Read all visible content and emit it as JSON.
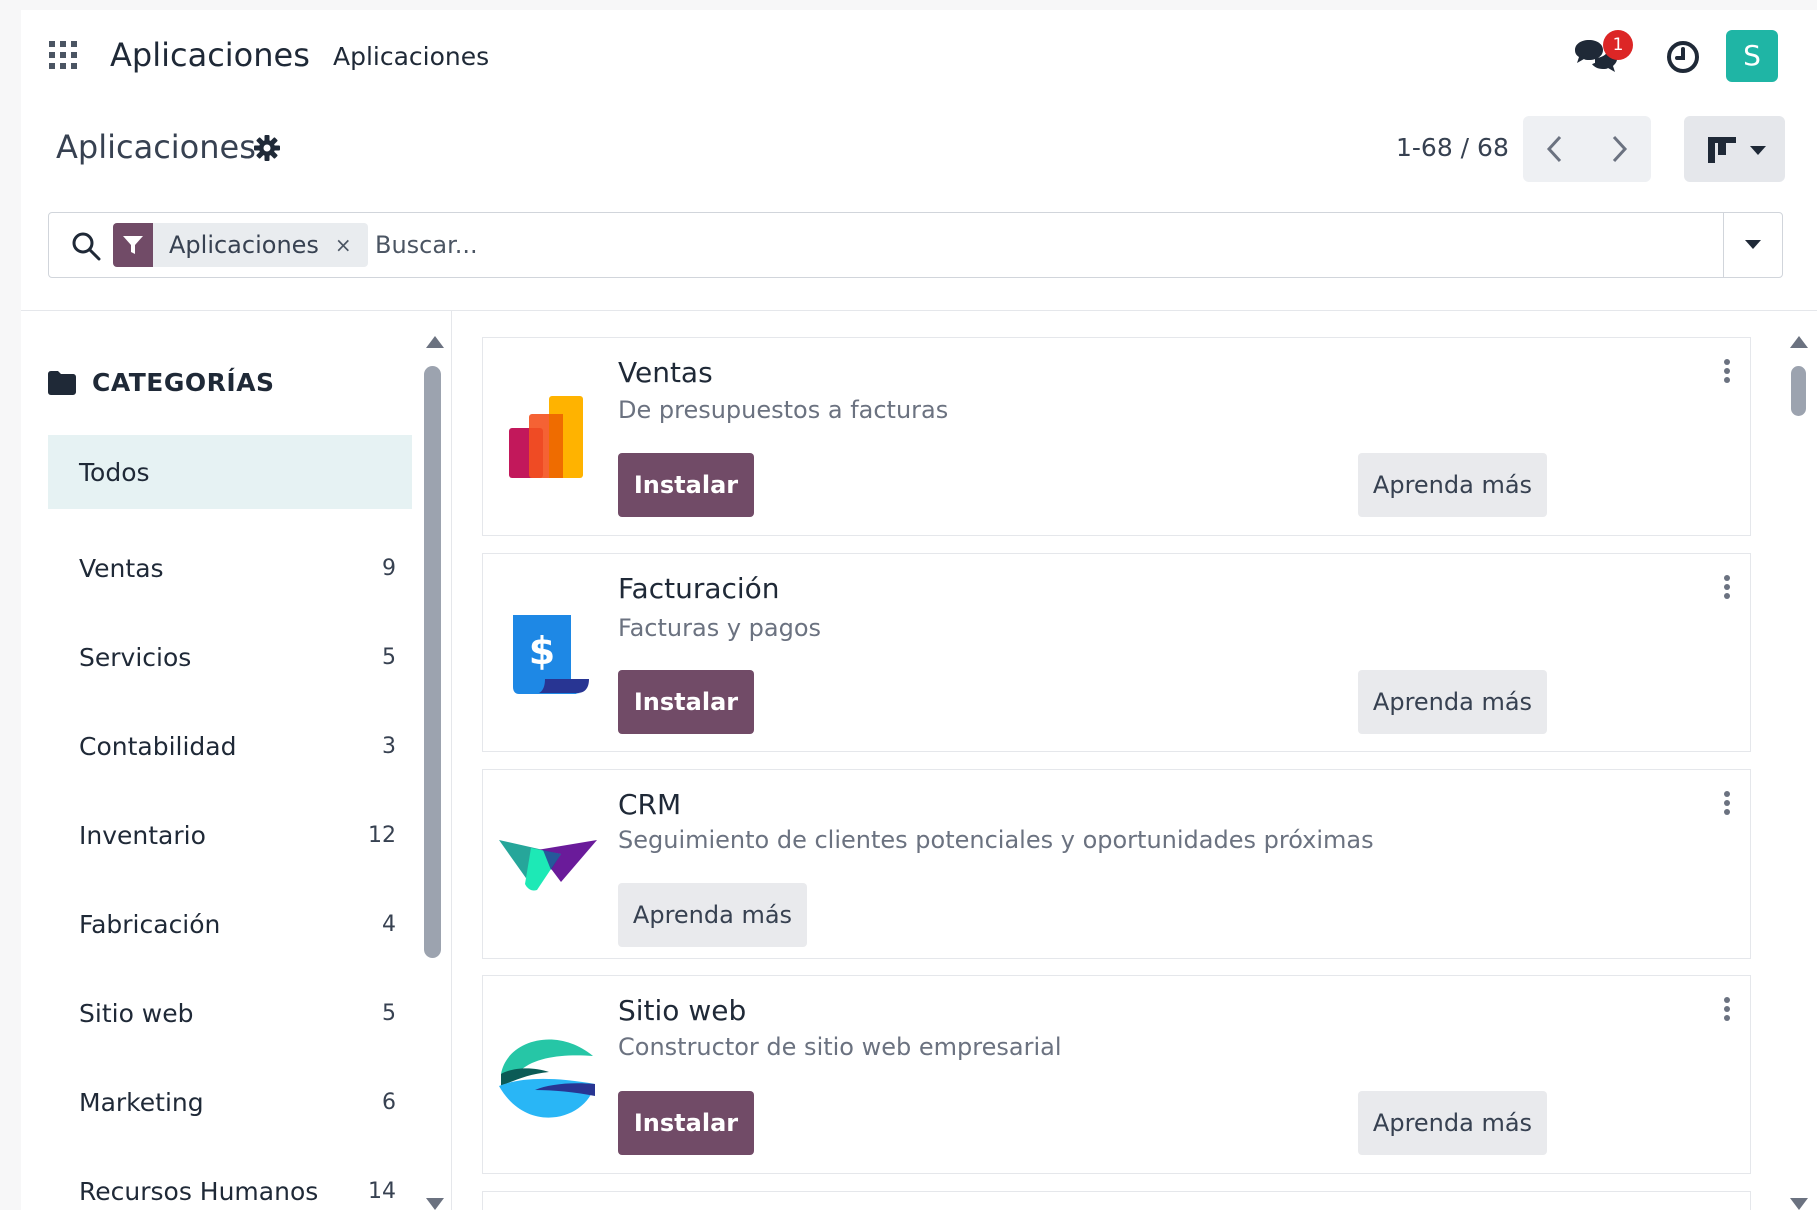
{
  "topnav": {
    "brand": "Aplicaciones",
    "menu_item": "Aplicaciones",
    "chat_badge": "1",
    "avatar_letter": "S"
  },
  "control_panel": {
    "title": "Aplicaciones",
    "pager": "1-68 / 68"
  },
  "search": {
    "facet_label": "Aplicaciones",
    "facet_remove": "×",
    "placeholder": "Buscar..."
  },
  "sidebar": {
    "title": "CATEGORÍAS",
    "items": [
      {
        "label": "Todos",
        "count": ""
      },
      {
        "label": "Ventas",
        "count": "9"
      },
      {
        "label": "Servicios",
        "count": "5"
      },
      {
        "label": "Contabilidad",
        "count": "3"
      },
      {
        "label": "Inventario",
        "count": "12"
      },
      {
        "label": "Fabricación",
        "count": "4"
      },
      {
        "label": "Sitio web",
        "count": "5"
      },
      {
        "label": "Marketing",
        "count": "6"
      },
      {
        "label": "Recursos Humanos",
        "count": "14"
      }
    ]
  },
  "apps": [
    {
      "name": "Ventas",
      "summary": "De presupuestos a facturas",
      "install": "Instalar",
      "learn": "Aprenda más"
    },
    {
      "name": "Facturación",
      "summary": "Facturas y pagos",
      "install": "Instalar",
      "learn": "Aprenda más"
    },
    {
      "name": "CRM",
      "summary": "Seguimiento de clientes potenciales y oportunidades próximas",
      "learn": "Aprenda más"
    },
    {
      "name": "Sitio web",
      "summary": "Constructor de sitio web empresarial",
      "install": "Instalar",
      "learn": "Aprenda más"
    }
  ],
  "colors": {
    "primary": "#714b67",
    "avatar": "#1fb5a5",
    "badge": "#dc2626",
    "active_category": "#e6f2f3"
  }
}
